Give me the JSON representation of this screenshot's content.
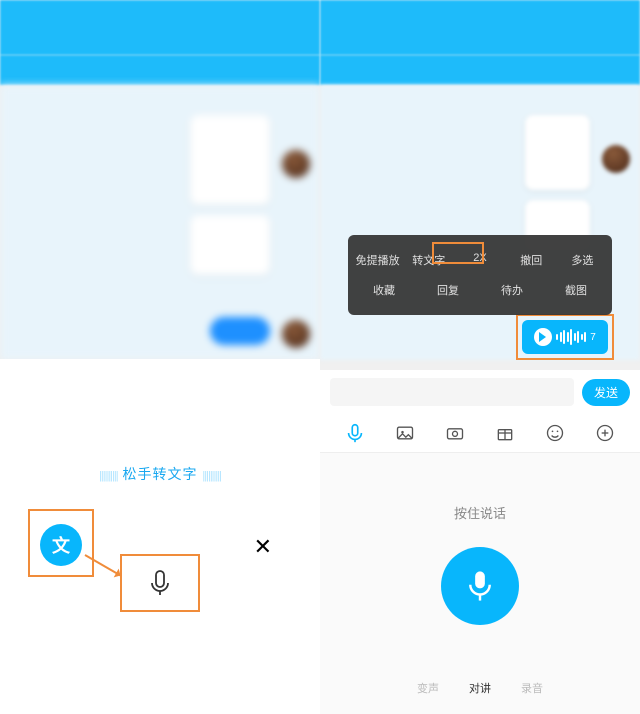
{
  "left": {
    "hintText": "松手转文字",
    "wenButton": "文",
    "closeX": "✕"
  },
  "right": {
    "contextMenu": {
      "row1": [
        "免提播放",
        "转文字",
        "2X",
        "撤回",
        "多选"
      ],
      "row2": [
        "收藏",
        "回复",
        "待办",
        "截图"
      ]
    },
    "voiceMsgDuration": "7",
    "sendButton": "发送",
    "holdToSpeak": "按住说话",
    "modes": {
      "left": "变声",
      "center": "对讲",
      "right": "录音"
    }
  }
}
